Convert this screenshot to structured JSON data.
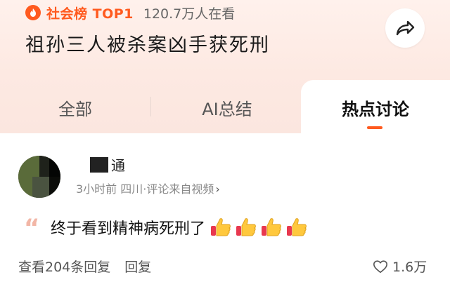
{
  "header": {
    "rank_label": "社会榜 TOP1",
    "viewers": "120.7万人在看",
    "title": "祖孙三人被杀案凶手获死刑",
    "share_icon": "share-icon"
  },
  "tabs": [
    {
      "label": "全部",
      "active": false
    },
    {
      "label": "AI总结",
      "active": false
    },
    {
      "label": "热点讨论",
      "active": true
    }
  ],
  "comment": {
    "username": "通",
    "meta": "3小时前 四川·评论来自视频",
    "text": "终于看到精神病死刑了",
    "emoji_count": 4,
    "emoji_name": "thumbs-up-icon",
    "view_replies": "查看204条回复",
    "reply_label": "回复",
    "likes": "1.6万"
  },
  "colors": {
    "accent": "#ff5a1f",
    "header_bg": "#fdeae3"
  }
}
